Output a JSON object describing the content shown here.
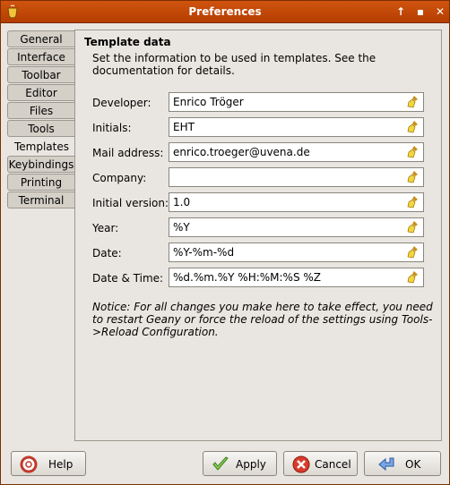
{
  "window": {
    "title": "Preferences"
  },
  "tabs": [
    {
      "label": "General"
    },
    {
      "label": "Interface"
    },
    {
      "label": "Toolbar"
    },
    {
      "label": "Editor"
    },
    {
      "label": "Files"
    },
    {
      "label": "Tools"
    },
    {
      "label": "Templates"
    },
    {
      "label": "Keybindings"
    },
    {
      "label": "Printing"
    },
    {
      "label": "Terminal"
    }
  ],
  "active_tab": "Templates",
  "templates": {
    "section_title": "Template data",
    "description": "Set the information to be used in templates. See the documentation for details.",
    "fields": [
      {
        "label": "Developer:",
        "value": "Enrico Tröger"
      },
      {
        "label": "Initials:",
        "value": "EHT"
      },
      {
        "label": "Mail address:",
        "value": "enrico.troeger@uvena.de"
      },
      {
        "label": "Company:",
        "value": ""
      },
      {
        "label": "Initial version:",
        "value": "1.0"
      },
      {
        "label": "Year:",
        "value": "%Y"
      },
      {
        "label": "Date:",
        "value": "%Y-%m-%d"
      },
      {
        "label": "Date & Time:",
        "value": "%d.%m.%Y %H:%M:%S %Z"
      }
    ],
    "notice": "Notice: For all changes you make here to take effect, you need to restart Geany or force the reload of the settings using Tools->Reload Configuration."
  },
  "buttons": {
    "help": "Help",
    "apply": "Apply",
    "cancel": "Cancel",
    "ok": "OK"
  }
}
